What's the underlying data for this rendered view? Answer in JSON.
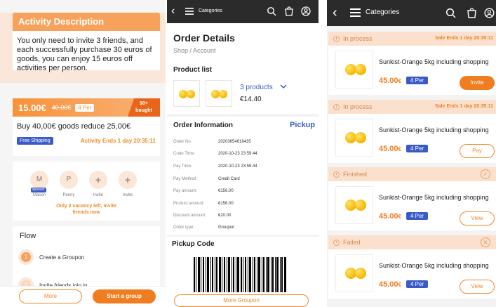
{
  "screen1": {
    "title": "Activity Description",
    "description": "You only need to invite 3 friends, and each successfully purchase 30 euros of goods, you can enjoy 15 euros off activities per person.",
    "price_now": "15.00€",
    "price_old": "40.00€",
    "per_label": "4 Per",
    "bought_count": "90+",
    "bought_label": "bought",
    "deal_text": "Buy 40,00€ goods reduce 25,00€",
    "shipping_badge": "Free Shipping",
    "activity_ends": "Activity Ends 1 day 20:35:11",
    "members": [
      {
        "initial": "M",
        "name": "Mason",
        "badge": "sponsor"
      },
      {
        "initial": "P",
        "name": "Penny"
      },
      {
        "initial": "+",
        "name": "Invite"
      },
      {
        "initial": "+",
        "name": "Invite"
      }
    ],
    "vacancy_text": "Only 2 vacancy left, invite friends now",
    "flow_title": "Flow",
    "flow_steps": [
      {
        "num": "1",
        "label": "Create a Groupon"
      },
      {
        "num": "2",
        "label": "Invite friends join in"
      }
    ],
    "more_button": "More",
    "start_button": "Start a group"
  },
  "screen2": {
    "menu_label": "Categories",
    "page_title": "Order Details",
    "breadcrumb": "Shop  /  Account",
    "product_list_title": "Product list",
    "products_count": "3 products",
    "products_total": "€14.40",
    "order_info_title": "Order Information",
    "pickup_link": "Pickup",
    "order_info": [
      {
        "key": "Order No:",
        "value": "20203654618435"
      },
      {
        "key": "Crate Time:",
        "value": "2020-10-23 23:59:44"
      },
      {
        "key": "Pay Time:",
        "value": "2020-10-23 23:59:44"
      },
      {
        "key": "Pay Method:",
        "value": "Credit Card"
      },
      {
        "key": "Pay amount:",
        "value": "€156.00"
      },
      {
        "key": "Product amount:",
        "value": "€156.00"
      },
      {
        "key": "Discount amount:",
        "value": "€20.00"
      },
      {
        "key": "Order type:",
        "value": "Groupon"
      }
    ],
    "pickup_code_title": "Pickup Code",
    "more_groupon_button": "More Groupon"
  },
  "screen3": {
    "menu_label": "Categories",
    "orders": [
      {
        "status": "In process",
        "sale_end": "Sale Ends 1 day 20:35:11",
        "name": "Sunkist-Orange 5kg including shopping",
        "price": "45.00",
        "currency": "€",
        "per": "4 Per",
        "action": "Invite",
        "action_style": "fill",
        "icon": "clock-icon"
      },
      {
        "status": "In process",
        "sale_end": "Sale Ends 1 day 20:35:11",
        "name": "Sunkist-Orange 5kg including shopping",
        "price": "45.00",
        "currency": "€",
        "per": "4 Per",
        "action": "Pay",
        "action_style": "outline",
        "icon": "clock-icon"
      },
      {
        "status": "Finished",
        "sale_end": "",
        "name": "Sunkist-Orange 5kg including shopping",
        "price": "45.00",
        "currency": "€",
        "per": "4 Per",
        "action": "View",
        "action_style": "outline",
        "icon": "check-icon"
      },
      {
        "status": "Failed",
        "sale_end": "",
        "name": "Sunkist-Orange 5kg including shopping",
        "price": "45.00",
        "currency": "€",
        "per": "4 Per",
        "action": "View",
        "action_style": "outline",
        "icon": "cross-icon"
      }
    ]
  },
  "colors": {
    "accent": "#f07d1f",
    "light_accent": "#fbe1cd",
    "badge_blue": "#3a5bc7",
    "topbar": "#2b2b2b"
  }
}
